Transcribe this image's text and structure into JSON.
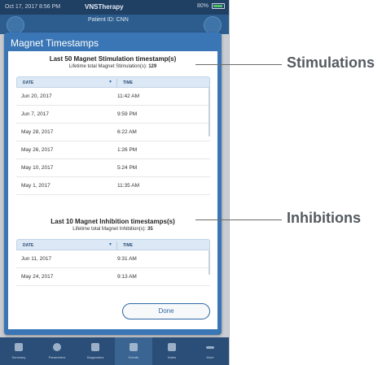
{
  "status_bar": {
    "datetime": "Oct 17, 2017  8:56 PM",
    "app_name": "VNSTherapy",
    "battery": "80%"
  },
  "app_header": {
    "patient_id": "Patient ID: CNN"
  },
  "dialog": {
    "title": "Magnet Timestamps",
    "stim_section": {
      "title": "Last 50 Magnet Stimulation timestamp(s)",
      "subtitle_label": "Lifetime total Magnet Stimulation(s):",
      "subtitle_value": "129",
      "header_date": "DATE",
      "header_time": "TIME",
      "sort_icon": "triangle-down",
      "rows": [
        {
          "date": "Jun 20, 2017",
          "time": "11:42 AM"
        },
        {
          "date": "Jun 7, 2017",
          "time": "9:59 PM"
        },
        {
          "date": "May 28, 2017",
          "time": "6:22 AM"
        },
        {
          "date": "May 26, 2017",
          "time": "1:26 PM"
        },
        {
          "date": "May 10, 2017",
          "time": "5:24 PM"
        },
        {
          "date": "May 1, 2017",
          "time": "11:35 AM"
        }
      ]
    },
    "inhib_section": {
      "title": "Last 10 Magnet Inhibition timestamps(s)",
      "subtitle_label": "Lifetime total Magnet Inhibition(s):",
      "subtitle_value": "35",
      "header_date": "DATE",
      "header_time": "TIME",
      "rows": [
        {
          "date": "Jun 11, 2017",
          "time": "9:31 AM"
        },
        {
          "date": "May 24, 2017",
          "time": "9:13 AM"
        }
      ]
    },
    "done_label": "Done"
  },
  "tab_bar": {
    "items": [
      "Summary",
      "Parameters",
      "Diagnostics",
      "Events",
      "Notes",
      "More"
    ]
  },
  "annotations": {
    "stimulations": "Stimulations",
    "inhibitions": "Inhibitions"
  }
}
